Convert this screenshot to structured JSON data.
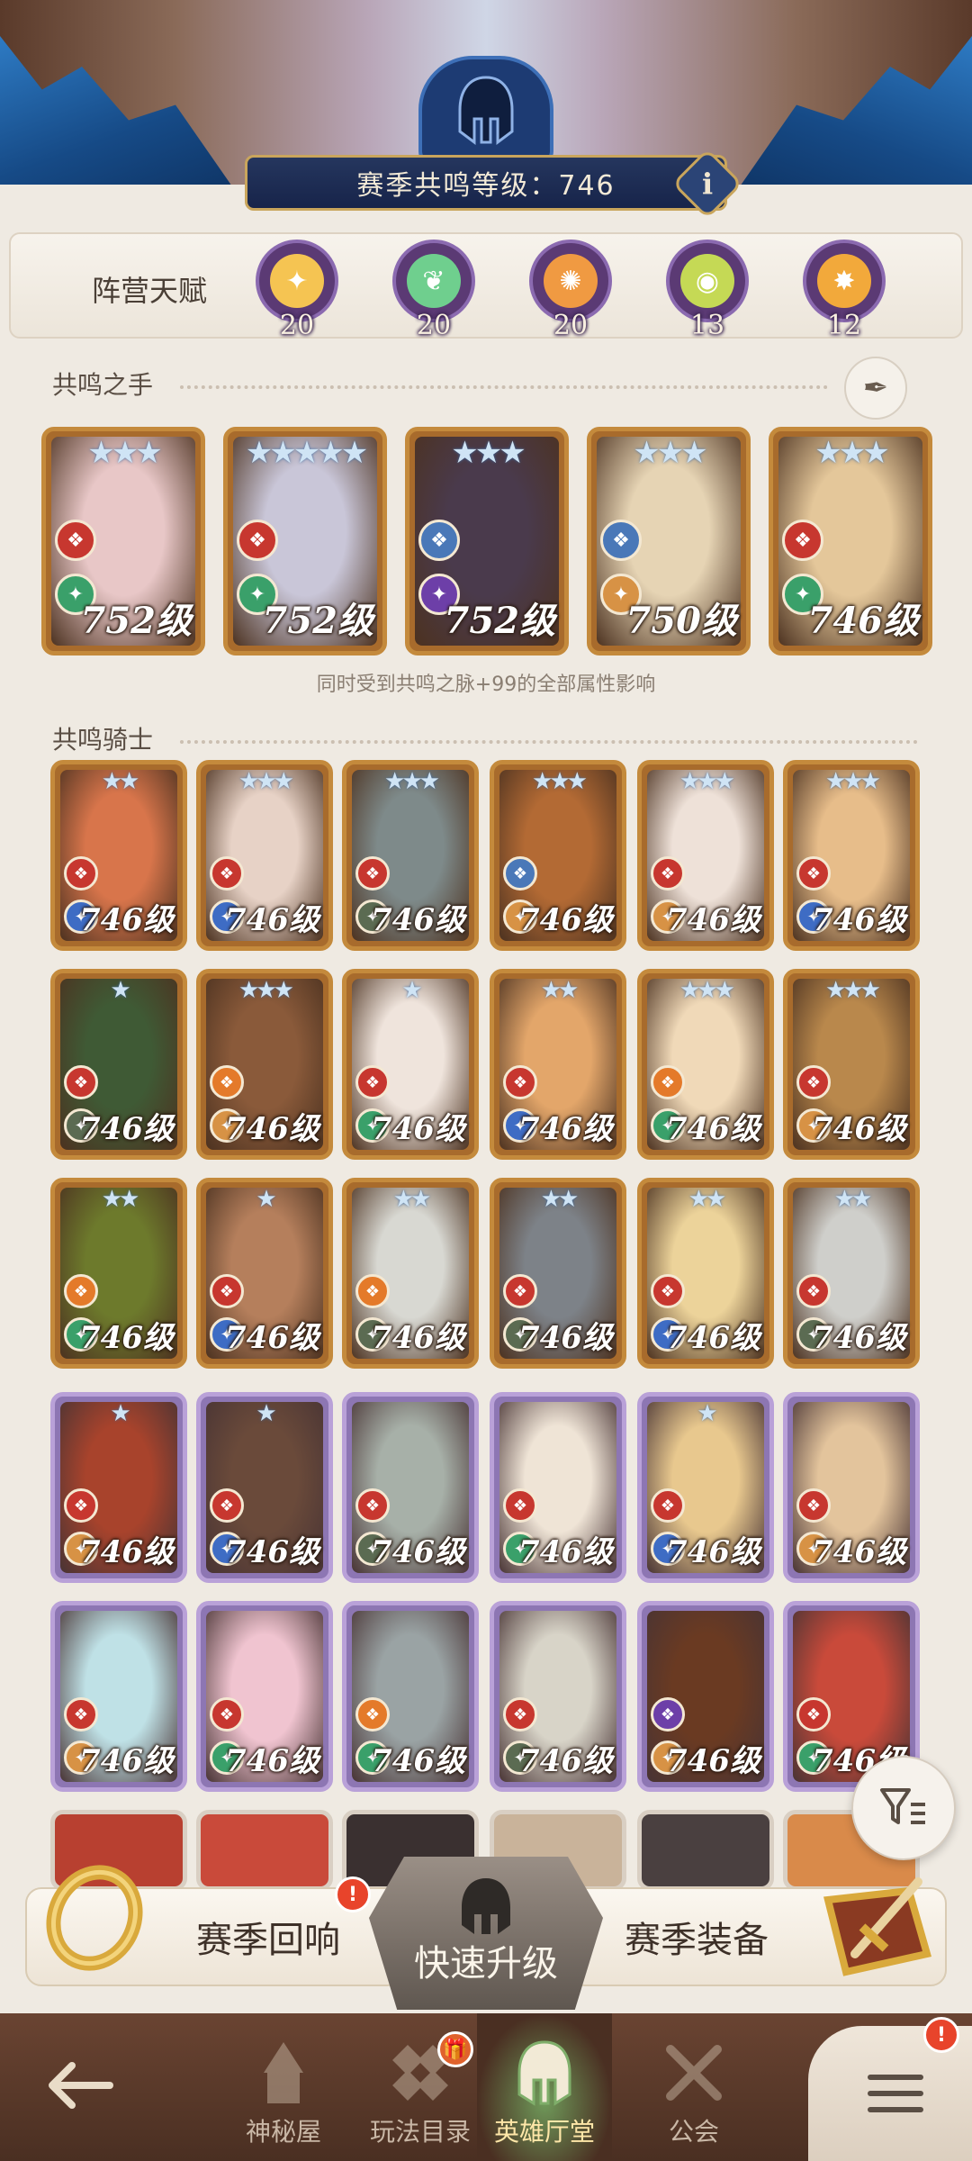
{
  "header": {
    "season_level_label": "赛季共鸣等级：746",
    "info_label": "i"
  },
  "faction_talent": {
    "label": "阵营天赋",
    "badges": [
      {
        "icon": "lightbearer-icon",
        "value": "20",
        "color": "#f5c452"
      },
      {
        "icon": "wilder-icon",
        "value": "20",
        "color": "#6fcf8e"
      },
      {
        "icon": "graveborn-icon",
        "value": "20",
        "color": "#f09a42"
      },
      {
        "icon": "mauler-icon",
        "value": "13",
        "color": "#c5d955"
      },
      {
        "icon": "celestial-icon",
        "value": "12",
        "color": "#f2a93b"
      }
    ]
  },
  "resonance_hands": {
    "title": "共鸣之手",
    "note": "同时受到共鸣之脉+99的全部属性影响",
    "heroes": [
      {
        "level": "752级",
        "stars": "★★★",
        "class_color": "#c7372f",
        "faction_color": "#3aa06a",
        "tone": "#e8c7c7"
      },
      {
        "level": "752级",
        "stars": "★★★★★",
        "class_color": "#c7372f",
        "faction_color": "#3aa06a",
        "tone": "#c9c6d8"
      },
      {
        "level": "752级",
        "stars": "★★★",
        "class_color": "#4a78b8",
        "faction_color": "#6d3fa8",
        "tone": "#4a3a4c"
      },
      {
        "level": "750级",
        "stars": "★★★",
        "class_color": "#4a78b8",
        "faction_color": "#d79245",
        "tone": "#e6d4b4"
      },
      {
        "level": "746级",
        "stars": "★★★",
        "class_color": "#c7372f",
        "faction_color": "#3aa06a",
        "tone": "#e4c79a"
      }
    ]
  },
  "resonance_knights": {
    "title": "共鸣骑士",
    "rows": [
      [
        {
          "level": "746级",
          "stars": "★★",
          "class_color": "#c7372f",
          "faction_color": "#3e6cc4",
          "tone": "#d8754b"
        },
        {
          "level": "746级",
          "stars": "★★★",
          "class_color": "#c7372f",
          "faction_color": "#3e6cc4",
          "tone": "#e7d2c6"
        },
        {
          "level": "746级",
          "stars": "★★★",
          "class_color": "#c7372f",
          "faction_color": "#5b6b52",
          "tone": "#7e8a8a"
        },
        {
          "level": "746级",
          "stars": "★★★",
          "class_color": "#4a78b8",
          "faction_color": "#d79245",
          "tone": "#b36a34"
        },
        {
          "level": "746级",
          "stars": "★★★",
          "class_color": "#c7372f",
          "faction_color": "#d79245",
          "tone": "#eee1d8"
        },
        {
          "level": "746级",
          "stars": "★★★",
          "class_color": "#c7372f",
          "faction_color": "#3e6cc4",
          "tone": "#e7bd8a"
        }
      ],
      [
        {
          "level": "746级",
          "stars": "★",
          "class_color": "#c7372f",
          "faction_color": "#5b6b52",
          "tone": "#3f5a35"
        },
        {
          "level": "746级",
          "stars": "★★★",
          "class_color": "#e47a2a",
          "faction_color": "#d79245",
          "tone": "#8a5a3a"
        },
        {
          "level": "746级",
          "stars": "★",
          "class_color": "#c7372f",
          "faction_color": "#3aa06a",
          "tone": "#efe4dc"
        },
        {
          "level": "746级",
          "stars": "★★",
          "class_color": "#c7372f",
          "faction_color": "#3e6cc4",
          "tone": "#e3a66a"
        },
        {
          "level": "746级",
          "stars": "★★★",
          "class_color": "#e47a2a",
          "faction_color": "#3aa06a",
          "tone": "#f0d9b8"
        },
        {
          "level": "746级",
          "stars": "★★★",
          "class_color": "#c7372f",
          "faction_color": "#d79245",
          "tone": "#b9884c"
        }
      ],
      [
        {
          "level": "746级",
          "stars": "★★",
          "class_color": "#e47a2a",
          "faction_color": "#3aa06a",
          "tone": "#6d7a2c"
        },
        {
          "level": "746级",
          "stars": "★",
          "class_color": "#c7372f",
          "faction_color": "#3e6cc4",
          "tone": "#b57f5c"
        },
        {
          "level": "746级",
          "stars": "★★",
          "class_color": "#e47a2a",
          "faction_color": "#5b6b52",
          "tone": "#d8d8d2"
        },
        {
          "level": "746级",
          "stars": "★★",
          "class_color": "#c7372f",
          "faction_color": "#5b6b52",
          "tone": "#7d8288"
        },
        {
          "level": "746级",
          "stars": "★★",
          "class_color": "#c7372f",
          "faction_color": "#3e6cc4",
          "tone": "#ecd39a"
        },
        {
          "level": "746级",
          "stars": "★★",
          "class_color": "#c7372f",
          "faction_color": "#5b6b52",
          "tone": "#cfcfcb"
        }
      ],
      [
        {
          "level": "746级",
          "stars": "★",
          "class_color": "#c7372f",
          "faction_color": "#d79245",
          "tone": "#a8432c"
        },
        {
          "level": "746级",
          "stars": "★",
          "class_color": "#c7372f",
          "faction_color": "#3e6cc4",
          "tone": "#6a4a3a"
        },
        {
          "level": "746级",
          "stars": "",
          "class_color": "#c7372f",
          "faction_color": "#5b6b52",
          "tone": "#a7b0a8"
        },
        {
          "level": "746级",
          "stars": "",
          "class_color": "#c7372f",
          "faction_color": "#3aa06a",
          "tone": "#efe4d6"
        },
        {
          "level": "746级",
          "stars": "★",
          "class_color": "#c7372f",
          "faction_color": "#3e6cc4",
          "tone": "#e8c88e"
        },
        {
          "level": "746级",
          "stars": "",
          "class_color": "#c7372f",
          "faction_color": "#d79245",
          "tone": "#e3c49c"
        }
      ],
      [
        {
          "level": "746级",
          "stars": "",
          "class_color": "#c7372f",
          "faction_color": "#d79245",
          "tone": "#bfe1e6"
        },
        {
          "level": "746级",
          "stars": "",
          "class_color": "#c7372f",
          "faction_color": "#3aa06a",
          "tone": "#f0c4d0"
        },
        {
          "level": "746级",
          "stars": "",
          "class_color": "#e47a2a",
          "faction_color": "#3aa06a",
          "tone": "#9aa3a4"
        },
        {
          "level": "746级",
          "stars": "",
          "class_color": "#c7372f",
          "faction_color": "#5b6b52",
          "tone": "#d8d4c8"
        },
        {
          "level": "746级",
          "stars": "",
          "class_color": "#6d3fa8",
          "faction_color": "#d79245",
          "tone": "#6a3a22"
        },
        {
          "level": "746级",
          "stars": "",
          "class_color": "#c7372f",
          "faction_color": "#3aa06a",
          "tone": "#c94a3a"
        }
      ]
    ]
  },
  "actions": {
    "season_echo": "赛季回响",
    "quick_level": "快速升级",
    "season_gear": "赛季装备",
    "badge": "!"
  },
  "nav": {
    "items": [
      {
        "label": "神秘屋",
        "icon": "mystery-house-icon",
        "active": false
      },
      {
        "label": "玩法目录",
        "icon": "game-modes-icon",
        "active": false
      },
      {
        "label": "英雄厅堂",
        "icon": "hero-hall-icon",
        "active": true
      },
      {
        "label": "公会",
        "icon": "guild-icon",
        "active": false
      }
    ],
    "badge": "!"
  }
}
